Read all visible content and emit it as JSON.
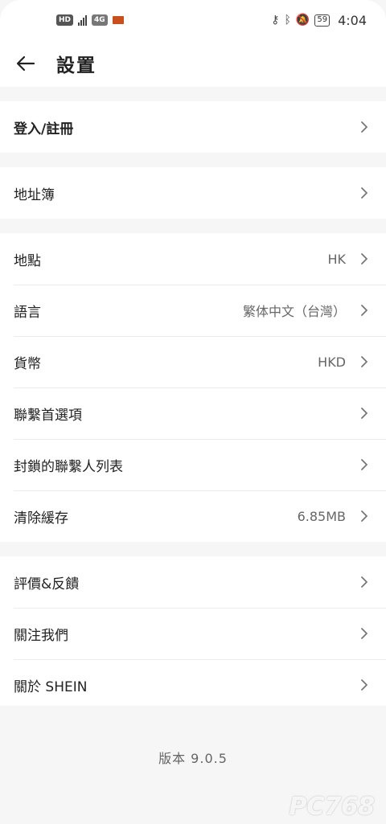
{
  "status_bar": {
    "hd_badge": "HD",
    "network": "4G",
    "battery": "59",
    "time": "4:04"
  },
  "header": {
    "title": "設置"
  },
  "groups": [
    {
      "items": [
        {
          "label": "登入/註冊",
          "value": ""
        }
      ]
    },
    {
      "items": [
        {
          "label": "地址簿",
          "value": ""
        }
      ]
    },
    {
      "items": [
        {
          "label": "地點",
          "value": "HK"
        },
        {
          "label": "語言",
          "value": "繁体中文（台灣）"
        },
        {
          "label": "貨幣",
          "value": "HKD"
        },
        {
          "label": "聯繫首選項",
          "value": ""
        },
        {
          "label": "封鎖的聯繫人列表",
          "value": ""
        },
        {
          "label": "清除緩存",
          "value": "6.85MB"
        }
      ]
    },
    {
      "items": [
        {
          "label": "評價&反饋",
          "value": ""
        },
        {
          "label": "關注我們",
          "value": ""
        },
        {
          "label": "關於 SHEIN",
          "value": ""
        }
      ]
    }
  ],
  "footer": {
    "version": "版本  9.0.5"
  },
  "watermark": "PC768"
}
